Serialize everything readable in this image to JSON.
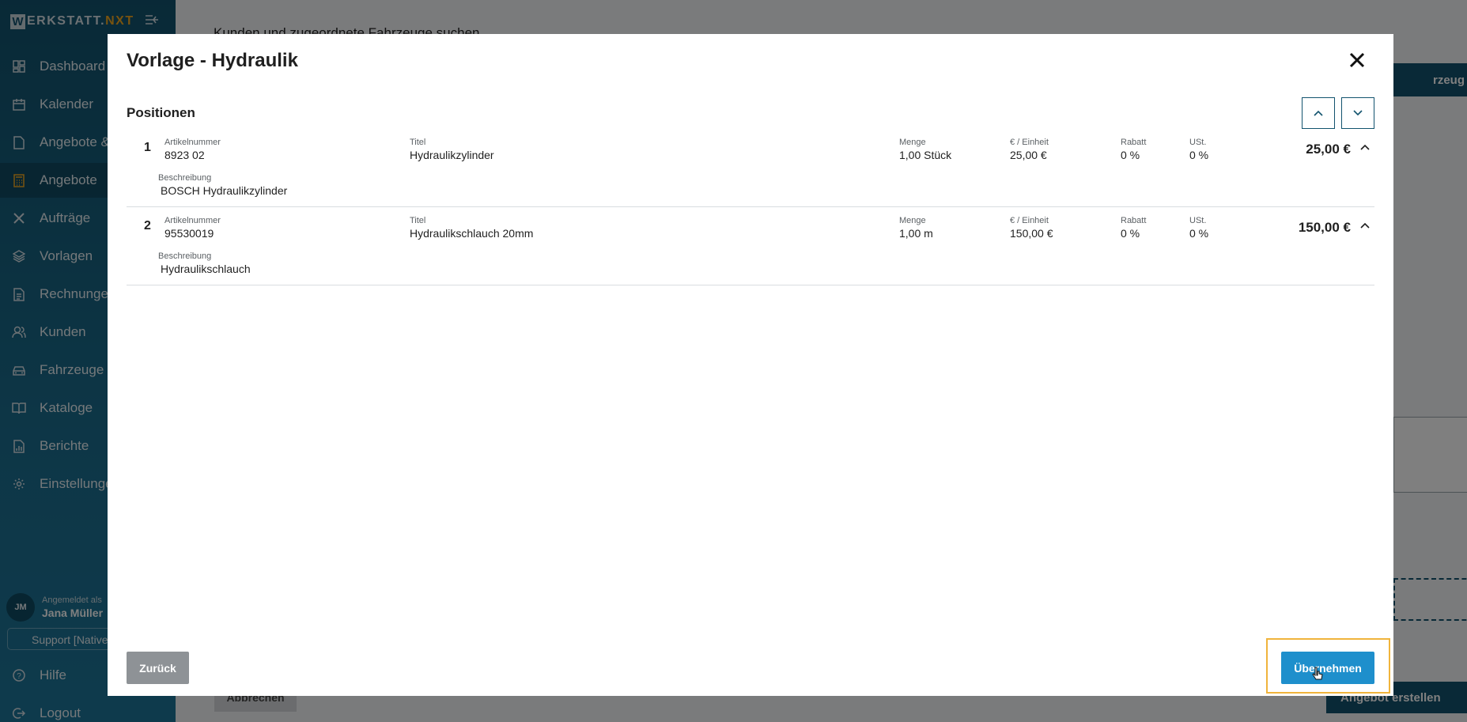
{
  "app": {
    "logo_main": "ERKSTATT.",
    "logo_letter": "W",
    "logo_accent": "NXT"
  },
  "sidebar": {
    "items": [
      {
        "label": "Dashboard",
        "icon": "dashboard-icon"
      },
      {
        "label": "Kalender",
        "icon": "calendar-icon"
      },
      {
        "label": "Angebote &",
        "icon": "document-icon"
      },
      {
        "label": "Angebote",
        "icon": "calculator-icon"
      },
      {
        "label": "Aufträge",
        "icon": "wrench-icon"
      },
      {
        "label": "Vorlagen",
        "icon": "layers-icon"
      },
      {
        "label": "Rechnungen",
        "icon": "invoice-icon"
      },
      {
        "label": "Kunden",
        "icon": "users-icon"
      },
      {
        "label": "Fahrzeuge",
        "icon": "car-icon"
      },
      {
        "label": "Kataloge",
        "icon": "book-icon"
      },
      {
        "label": "Berichte",
        "icon": "report-icon"
      },
      {
        "label": "Einstellungen",
        "icon": "gear-icon"
      }
    ],
    "active_index": 3,
    "user": {
      "logged_in_as": "Angemeldet als",
      "name": "Jana Müller",
      "initials": "JM"
    },
    "support": "Support [Native",
    "help": "Hilfe",
    "logout": "Logout"
  },
  "background": {
    "title": "Kunden und zugeordnete Fahrzeuge suchen",
    "top_button": "rzeug",
    "cancel": "Abbrechen",
    "create_offer": "Angebot erstellen"
  },
  "modal": {
    "title": "Vorlage - Hydraulik",
    "section": "Positionen",
    "labels": {
      "artikelnummer": "Artikelnummer",
      "titel": "Titel",
      "menge": "Menge",
      "einheit": "€ / Einheit",
      "rabatt": "Rabatt",
      "ust": "USt.",
      "beschreibung": "Beschreibung"
    },
    "positions": [
      {
        "num": "1",
        "artikelnummer": "8923 02",
        "titel": "Hydraulikzylinder",
        "menge": "1,00 Stück",
        "einheit": "25,00 €",
        "rabatt": "0 %",
        "ust": "0 %",
        "total": "25,00 €",
        "beschreibung": "BOSCH Hydraulikzylinder"
      },
      {
        "num": "2",
        "artikelnummer": "95530019",
        "titel": "Hydraulikschlauch 20mm",
        "menge": "1,00 m",
        "einheit": "150,00 €",
        "rabatt": "0 %",
        "ust": "0 %",
        "total": "150,00 €",
        "beschreibung": "Hydraulikschlauch"
      }
    ],
    "back": "Zurück",
    "apply": "Übernehmen"
  },
  "colors": {
    "sidebar": "#12536e",
    "accent": "#f0a61f",
    "primary_button": "#1e8fcc",
    "secondary_button": "#8e9296"
  }
}
